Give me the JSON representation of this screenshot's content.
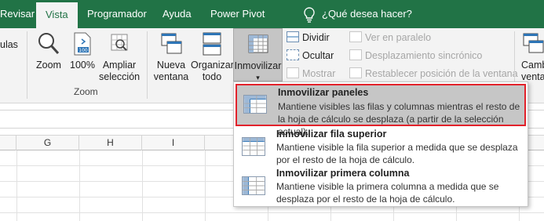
{
  "tabs": [
    {
      "label": "Revisar"
    },
    {
      "label": "Vista"
    },
    {
      "label": "Programador"
    },
    {
      "label": "Ayuda"
    },
    {
      "label": "Power Pivot"
    }
  ],
  "tell_me": "¿Qué desea hacer?",
  "ribbon": {
    "cut_left_label": "ulas",
    "zoom": "Zoom",
    "zoom100": "100%",
    "ampliar_line1": "Ampliar",
    "ampliar_line2": "selección",
    "zoom_group_label": "Zoom",
    "nueva_line1": "Nueva",
    "nueva_line2": "ventana",
    "organizar_line1": "Organizar",
    "organizar_line2": "todo",
    "inmovilizar": "Inmovilizar",
    "dividir": "Dividir",
    "ocultar": "Ocultar",
    "mostrar": "Mostrar",
    "ver_paralelo": "Ver en paralelo",
    "desplazamiento": "Desplazamiento sincrónico",
    "restablecer": "Restablecer posición de la ventana",
    "cambiar_line1": "Camb",
    "cambiar_line2": "venta"
  },
  "columns": [
    "G",
    "H",
    "I"
  ],
  "menu": [
    {
      "title": "Inmovilizar paneles",
      "desc": "Mantiene visibles las filas y columnas mientras el resto de la hoja de cálculo se desplaza (a partir de la selección actual)."
    },
    {
      "title": "Inmovilizar fila superior",
      "desc": "Mantiene visible la fila superior a medida que se desplaza por el resto de la hoja de cálculo."
    },
    {
      "title": "Inmovilizar primera columna",
      "desc": "Mantiene visible la primera columna a medida que se desplaza por el resto de la hoja de cálculo."
    }
  ],
  "colors": {
    "excel_green": "#217346",
    "highlight_border": "#e2222b",
    "highlight_fill": "#c6c6c6"
  }
}
